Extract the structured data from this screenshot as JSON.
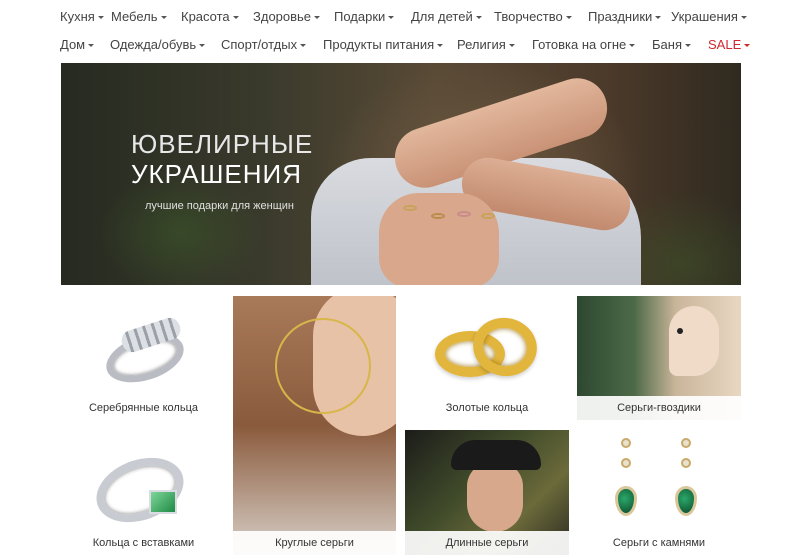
{
  "nav": {
    "row1": [
      {
        "label": "Кухня"
      },
      {
        "label": "Мебель"
      },
      {
        "label": "Красота"
      },
      {
        "label": "Здоровье"
      },
      {
        "label": "Подарки"
      },
      {
        "label": "Для детей"
      },
      {
        "label": "Творчество"
      },
      {
        "label": "Праздники"
      },
      {
        "label": "Украшения"
      }
    ],
    "row2": [
      {
        "label": "Дом"
      },
      {
        "label": "Одежда/обувь"
      },
      {
        "label": "Спорт/отдых"
      },
      {
        "label": "Продукты питания"
      },
      {
        "label": "Религия"
      },
      {
        "label": "Готовка на огне"
      },
      {
        "label": "Баня"
      },
      {
        "label": "SALE"
      }
    ],
    "sale_color": "#d0282e"
  },
  "hero": {
    "title_line1": "ЮВЕЛИРНЫЕ",
    "title_line2": "УКРАШЕНИЯ",
    "subtitle": "лучшие подарки для женщин"
  },
  "tiles": [
    {
      "label": "Серебрянные кольца"
    },
    {
      "label": "Круглые серьги"
    },
    {
      "label": "Золотые кольца"
    },
    {
      "label": "Серьги-гвоздики"
    },
    {
      "label": "Кольца с вставками"
    },
    {
      "label": "Длинные серьги"
    },
    {
      "label": "Серьги с камнями"
    }
  ]
}
